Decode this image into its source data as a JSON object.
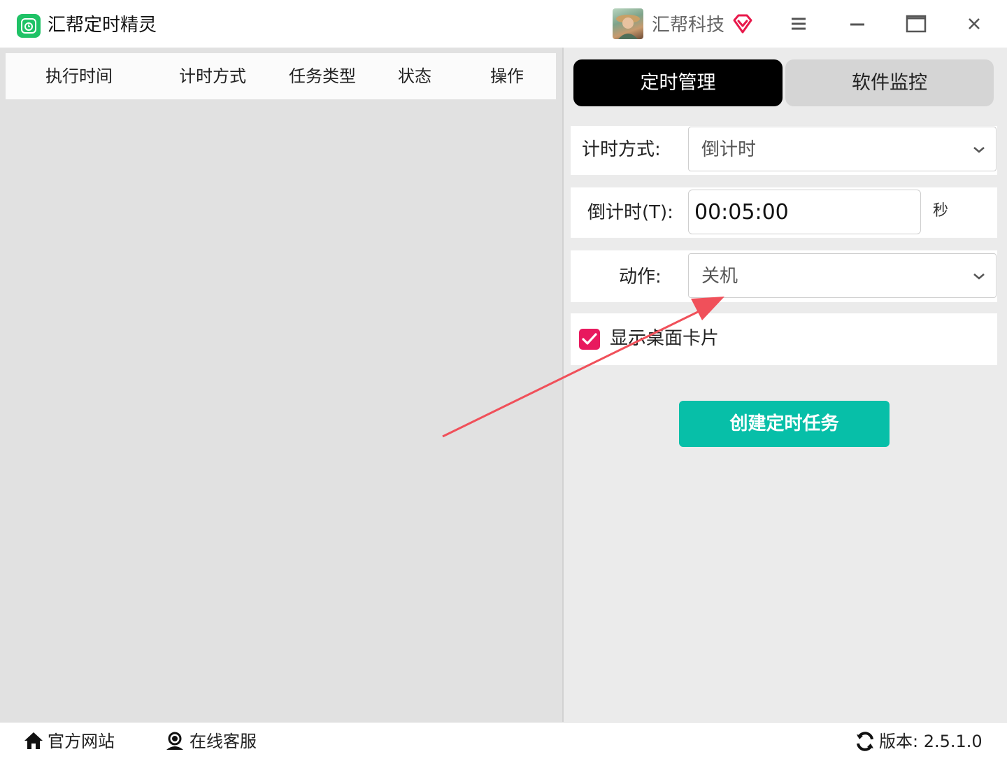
{
  "app": {
    "title": "汇帮定时精灵",
    "company": "汇帮科技"
  },
  "window_controls": {
    "menu_icon": "hamburger-menu-icon",
    "minimize_icon": "minimize-icon",
    "maximize_icon": "maximize-icon",
    "close_icon": "close-icon"
  },
  "task_table": {
    "columns": [
      "执行时间",
      "计时方式",
      "任务类型",
      "状态",
      "操作"
    ],
    "rows": []
  },
  "tabs": {
    "active": "定时管理",
    "inactive": "软件监控"
  },
  "form": {
    "timing_mode": {
      "label": "计时方式:",
      "value": "倒计时"
    },
    "countdown": {
      "label": "倒计时(T):",
      "value": "00:05:00",
      "unit": "秒"
    },
    "action": {
      "label": "动作:",
      "value": "关机"
    },
    "show_card": {
      "label": "显示桌面卡片",
      "checked": true
    },
    "create_button": "创建定时任务"
  },
  "statusbar": {
    "website": "官方网站",
    "support": "在线客服",
    "version": "版本: 2.5.1.0"
  },
  "colors": {
    "accent_teal": "#07bfa8",
    "checkbox_pink": "#e8195e",
    "logo_green": "#1fc266",
    "arrow_red": "#f0505a",
    "vip_red": "#e8194b"
  }
}
